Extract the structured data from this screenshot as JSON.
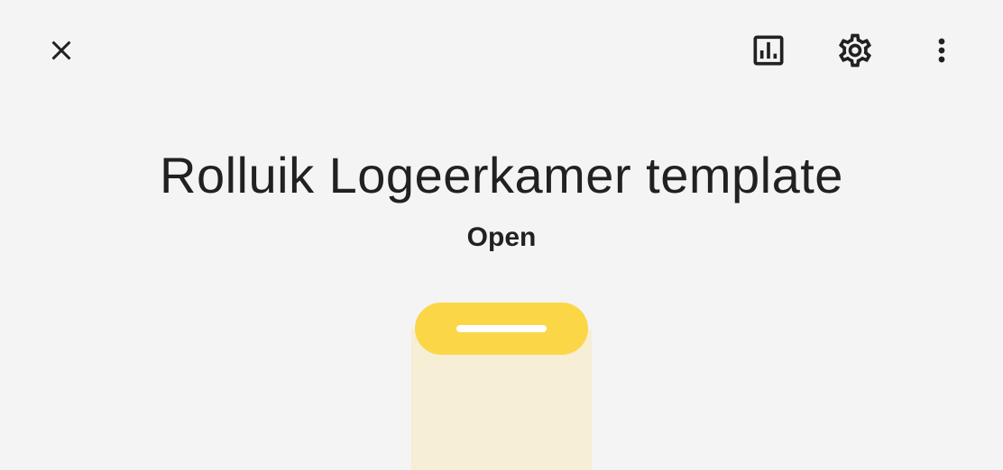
{
  "window": {
    "title": "Rolluik Logeerkamer template",
    "state": "Open"
  },
  "toolbar": {
    "icons": [
      "close-icon",
      "history-chart-icon",
      "gear-icon",
      "more-vertical-icon"
    ]
  },
  "cover": {
    "position_percent": 100
  },
  "colors": {
    "background": "#f4f4f4",
    "accent": "#fbd748",
    "track": "#f6eed5",
    "text": "#212121"
  }
}
